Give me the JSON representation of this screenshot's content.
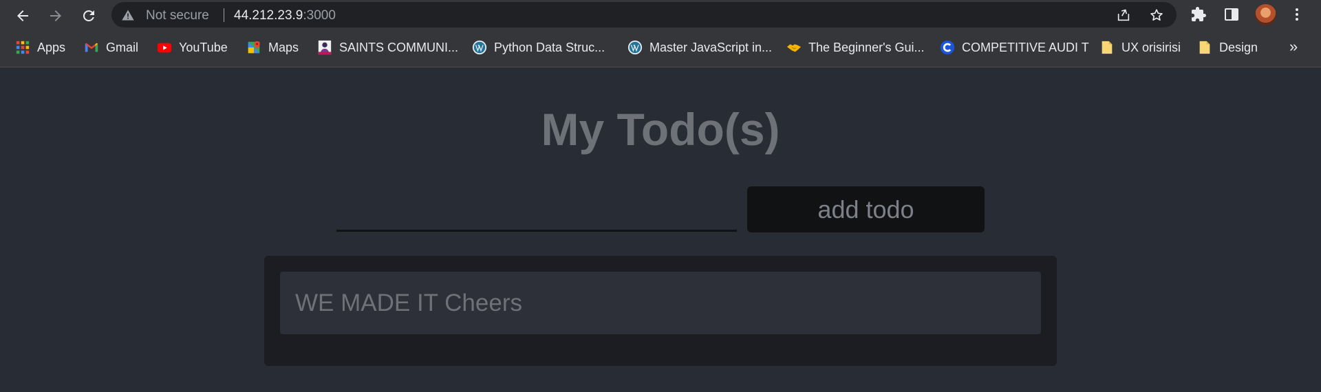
{
  "browser": {
    "security_label": "Not secure",
    "url_host": "44.212.23.9",
    "url_port": ":3000"
  },
  "bookmarks": {
    "items": [
      {
        "label": "Apps",
        "icon": "apps-grid-icon"
      },
      {
        "label": "Gmail",
        "icon": "gmail-icon"
      },
      {
        "label": "YouTube",
        "icon": "youtube-icon"
      },
      {
        "label": "Maps",
        "icon": "maps-icon"
      },
      {
        "label": "SAINTS COMMUNI...",
        "icon": "saints-avatar-icon"
      },
      {
        "label": "Python  Data Struc...",
        "icon": "wordpress-icon"
      },
      {
        "label": "Master JavaScript in...",
        "icon": "wordpress-icon"
      },
      {
        "label": "The Beginner's Gui...",
        "icon": "handshake-icon"
      },
      {
        "label": "COMPETITIVE AUDI T",
        "icon": "c-logo-icon"
      },
      {
        "label": "UX orisirisi",
        "icon": "folder-icon"
      },
      {
        "label": "Design",
        "icon": "folder-icon"
      }
    ],
    "more_label": "»"
  },
  "app": {
    "title": "My Todo(s)",
    "input_value": "",
    "add_button_label": "add todo",
    "todos": [
      {
        "text": "WE MADE IT Cheers"
      }
    ]
  },
  "colors": {
    "page_background": "#282c34",
    "chrome_background": "#35363a",
    "omnibox_background": "#202124",
    "title_text": "#6f7179",
    "button_background": "#111213",
    "list_background": "#1b1d22",
    "item_background": "#2d3039"
  }
}
